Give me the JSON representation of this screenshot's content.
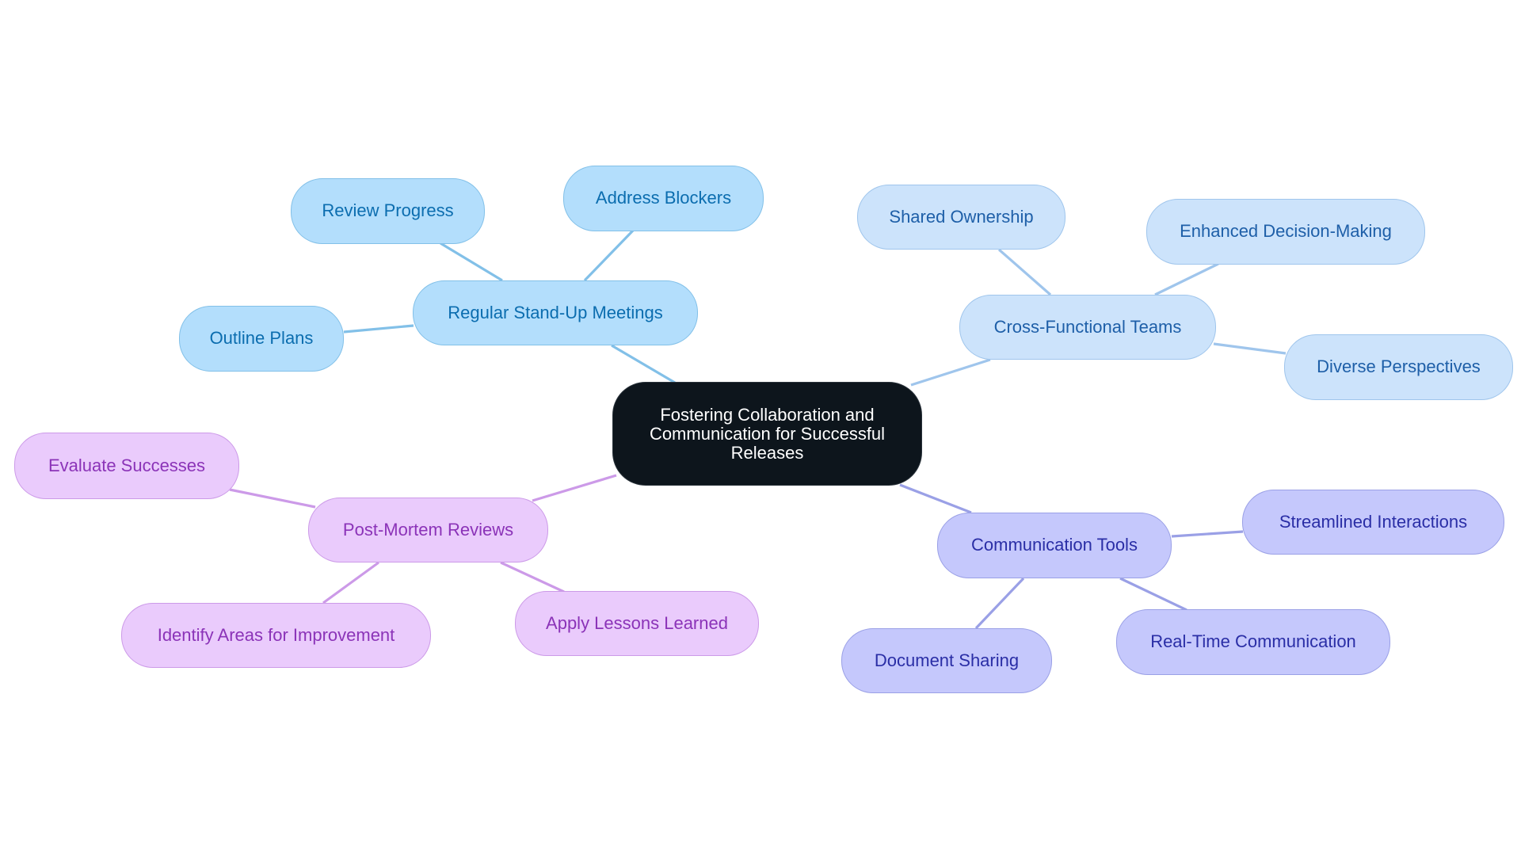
{
  "mindmap": {
    "root": {
      "label": "Fostering Collaboration and Communication for Successful Releases"
    },
    "branches": [
      {
        "id": "standup",
        "label": "Regular Stand-Up Meetings",
        "colors": {
          "fill": "#B3DEFC",
          "stroke": "#82C0E8",
          "text": "#0B6DAF"
        },
        "children": [
          "Review Progress",
          "Address Blockers",
          "Outline Plans"
        ]
      },
      {
        "id": "cross",
        "label": "Cross-Functional Teams",
        "colors": {
          "fill": "#CCE3FB",
          "stroke": "#9FC5EC",
          "text": "#1E5FA8"
        },
        "children": [
          "Shared Ownership",
          "Enhanced Decision-Making",
          "Diverse Perspectives"
        ]
      },
      {
        "id": "post",
        "label": "Post-Mortem Reviews",
        "colors": {
          "fill": "#EACBFC",
          "stroke": "#CC9AE8",
          "text": "#8B33B8"
        },
        "children": [
          "Evaluate Successes",
          "Identify Areas for Improvement",
          "Apply Lessons Learned"
        ]
      },
      {
        "id": "comm",
        "label": "Communication Tools",
        "colors": {
          "fill": "#C5C8FC",
          "stroke": "#9AA0E6",
          "text": "#2A2EA6"
        },
        "children": [
          "Streamlined Interactions",
          "Document Sharing",
          "Real-Time Communication"
        ]
      }
    ]
  }
}
